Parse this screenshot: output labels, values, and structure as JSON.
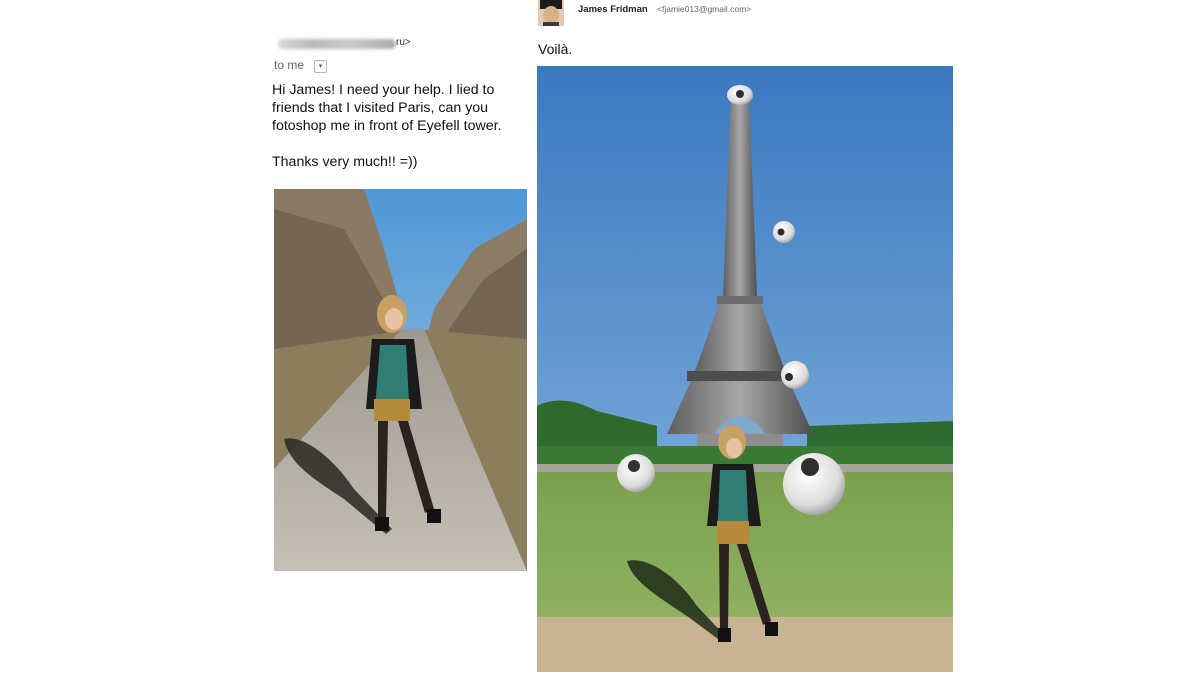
{
  "left_email": {
    "sender_suffix": "ru>",
    "recipient_label": "to me",
    "recipient_dropdown_icon": "chevron-down-icon",
    "body_lines": [
      "Hi James! I need your help. I lied to",
      "friends that I visited Paris, can you",
      "fotoshop me in front of Eyefell tower."
    ],
    "thanks": "Thanks very much!! =))"
  },
  "right_email": {
    "sender_name": "James Fridman",
    "sender_email": "<fjamie013@gmail.com>",
    "message": "Voilà."
  },
  "colors": {
    "sky_left": "#5fa4d8",
    "sky_right": "#3f7fc4",
    "grass": "#7ea657",
    "road": "#b7b3ab"
  }
}
